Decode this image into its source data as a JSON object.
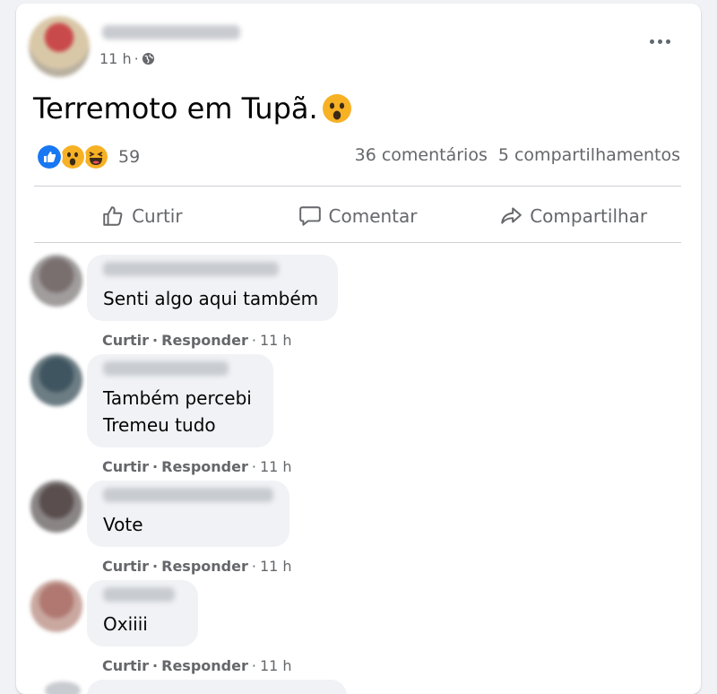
{
  "post": {
    "time": "11 h",
    "separator": "·",
    "text": "Terremoto em Tupã.",
    "reaction_count": "59",
    "comments": "36 comentários",
    "shares": "5 compartilhamentos"
  },
  "actions": {
    "like": "Curtir",
    "comment": "Comentar",
    "share": "Compartilhar"
  },
  "comments": [
    {
      "text": "Senti algo aqui também",
      "like": "Curtir",
      "reply": "Responder",
      "time": "11 h"
    },
    {
      "text": "Também percebi\nTremeu tudo",
      "like": "Curtir",
      "reply": "Responder",
      "time": "11 h"
    },
    {
      "text": "Vote",
      "like": "Curtir",
      "reply": "Responder",
      "time": "11 h"
    },
    {
      "text": "Oxiiii",
      "like": "Curtir",
      "reply": "Responder",
      "time": "11 h"
    }
  ],
  "colors": {
    "like_blue": "#1877f2",
    "emoji_yellow": "#f7b125",
    "text_secondary": "#65676b"
  },
  "icons": [
    "globe-icon",
    "more-icon",
    "like-reaction-icon",
    "wow-reaction-icon",
    "haha-reaction-icon",
    "thumbs-up-icon",
    "comment-icon",
    "share-icon"
  ]
}
